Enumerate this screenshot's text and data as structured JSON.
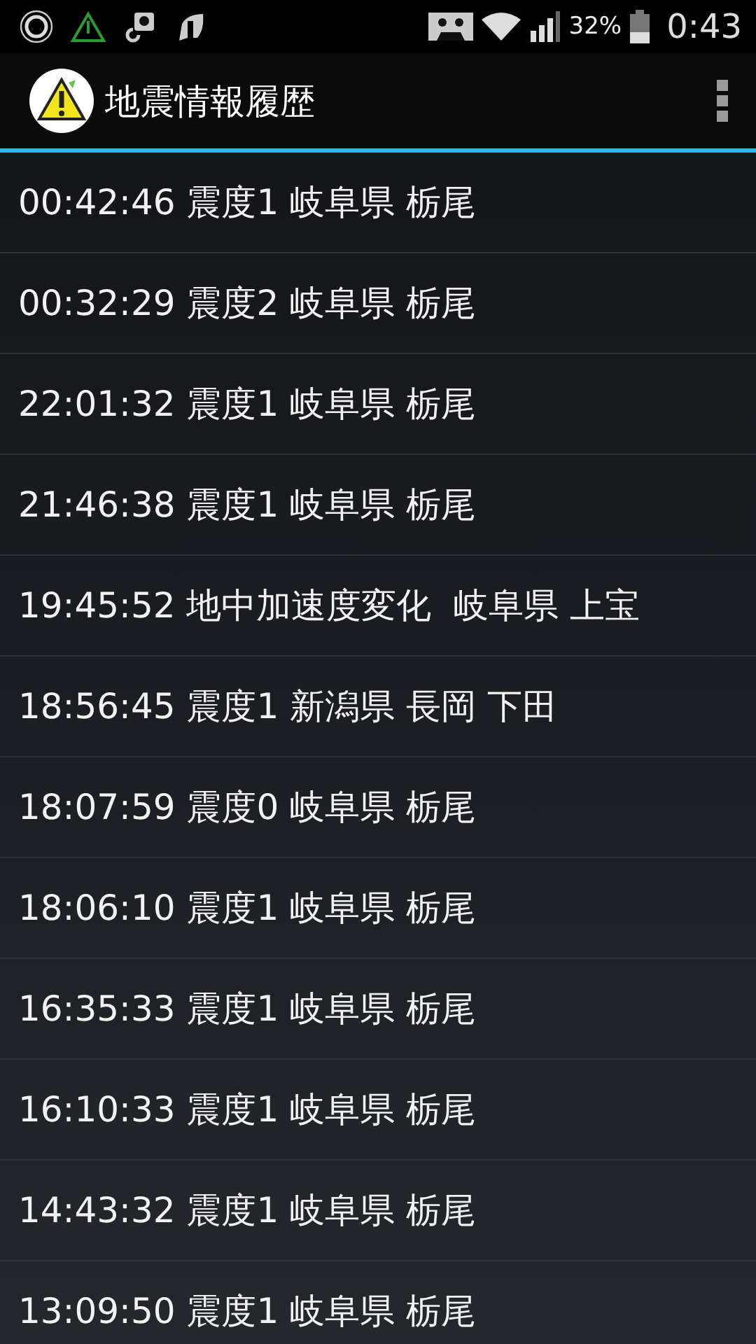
{
  "status_bar": {
    "battery": "32%",
    "time": "0:43"
  },
  "app_bar": {
    "title": "地震情報履歴"
  },
  "history": [
    "00:42:46 震度1 岐阜県 栃尾",
    "00:32:29 震度2 岐阜県 栃尾",
    "22:01:32 震度1 岐阜県 栃尾",
    "21:46:38 震度1 岐阜県 栃尾",
    "19:45:52 地中加速度変化  岐阜県 上宝",
    "18:56:45 震度1 新潟県 長岡 下田",
    "18:07:59 震度0 岐阜県 栃尾",
    "18:06:10 震度1 岐阜県 栃尾",
    "16:35:33 震度1 岐阜県 栃尾",
    "16:10:33 震度1 岐阜県 栃尾",
    "14:43:32 震度1 岐阜県 栃尾",
    "13:09:50 震度1 岐阜県 栃尾"
  ]
}
